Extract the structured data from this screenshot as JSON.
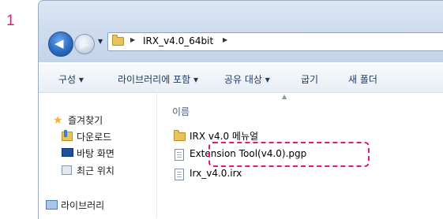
{
  "step_number": "1",
  "navigation": {
    "back_icon": "back-arrow-icon",
    "forward_icon": "forward-arrow-icon"
  },
  "address_bar": {
    "path": "IRX_v4.0_64bit"
  },
  "toolbar": {
    "organize": "구성 ▾",
    "include_in_library": "라이브러리에 포함 ▾",
    "share_with": "공유 대상 ▾",
    "burn": "굽기",
    "new_folder": "새 폴더"
  },
  "sidebar": {
    "favorites": "즐겨찾기",
    "downloads": "다운로드",
    "desktop": "바탕 화면",
    "recent_places": "최근 위치",
    "libraries": "라이브러리"
  },
  "file_list": {
    "column_name": "이름",
    "items": [
      {
        "name": "IRX v4.0 메뉴얼",
        "type": "folder"
      },
      {
        "name": "Extension Tool(v4.0).pgp",
        "type": "file"
      },
      {
        "name": "Irx_v4.0.irx",
        "type": "file"
      }
    ]
  },
  "colors": {
    "highlight": "#e6147f",
    "titlebar": "#cfddef"
  }
}
